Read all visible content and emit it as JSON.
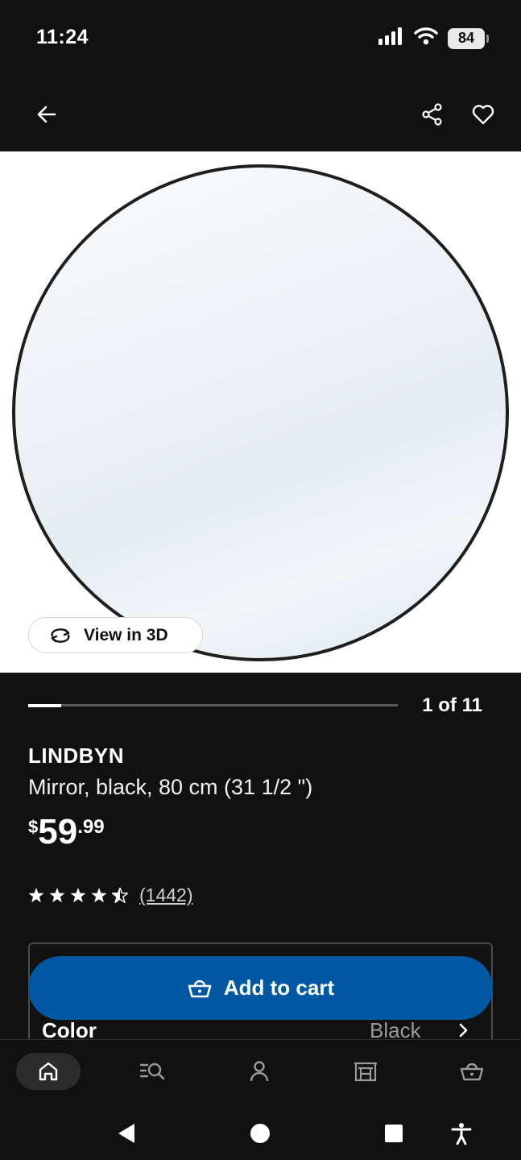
{
  "status_bar": {
    "time": "11:24",
    "battery": "84"
  },
  "product": {
    "name": "LINDBYN",
    "description": "Mirror, black, 80 cm (31 1/2 \")",
    "price_currency": "$",
    "price_integer": "59",
    "price_decimal": ".99",
    "rating_stars": 4.5,
    "review_count": "(1442)"
  },
  "gallery": {
    "view_3d_label": "View in 3D",
    "counter": "1 of 11",
    "progress_fraction": 0.09
  },
  "options": {
    "color_label": "Color",
    "color_value": "Black"
  },
  "actions": {
    "add_to_cart_label": "Add to cart"
  },
  "colors": {
    "background": "#111111",
    "accent": "#0058a3"
  },
  "icons": {
    "top_bar": [
      "back-arrow-icon",
      "share-icon",
      "heart-icon"
    ],
    "bottom_nav": [
      "home-icon",
      "search-list-icon",
      "profile-icon",
      "store-icon",
      "cart-basket-icon"
    ]
  }
}
